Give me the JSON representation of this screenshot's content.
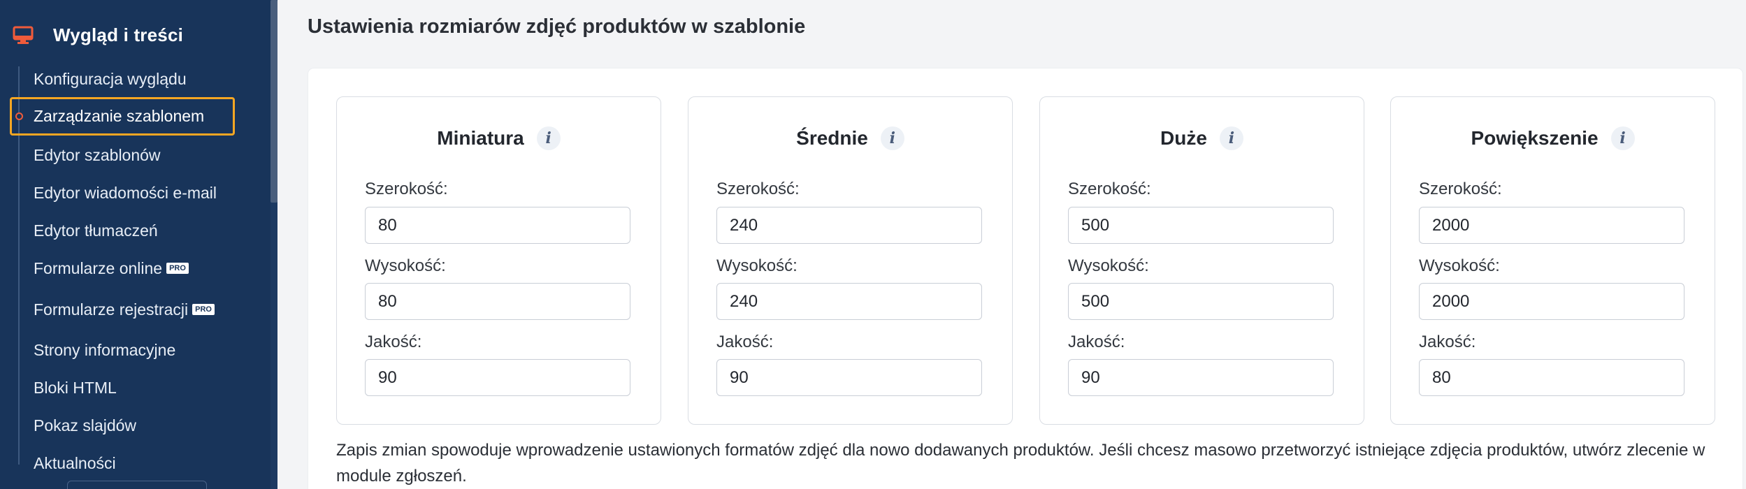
{
  "sidebar": {
    "section_title": "Wygląd i treści",
    "items": [
      {
        "label": "Konfiguracja wyglądu",
        "pro": false
      },
      {
        "label": "Zarządzanie szablonem",
        "pro": false,
        "active": true
      },
      {
        "label": "Edytor szablonów",
        "pro": false
      },
      {
        "label": "Edytor wiadomości e-mail",
        "pro": false
      },
      {
        "label": "Edytor tłumaczeń",
        "pro": false
      },
      {
        "label": "Formularze online",
        "pro": true
      },
      {
        "label": "Formularze rejestracji",
        "pro": true
      },
      {
        "label": "Strony informacyjne",
        "pro": false
      },
      {
        "label": "Bloki HTML",
        "pro": false
      },
      {
        "label": "Pokaz slajdów",
        "pro": false
      },
      {
        "label": "Aktualności",
        "pro": false
      }
    ],
    "pro_badge": "PRO"
  },
  "main": {
    "title": "Ustawienia rozmiarów zdjęć produktów w szablonie",
    "labels": {
      "width": "Szerokość:",
      "height": "Wysokość:",
      "quality": "Jakość:"
    },
    "cards": [
      {
        "title": "Miniatura",
        "width": "80",
        "height": "80",
        "quality": "90"
      },
      {
        "title": "Średnie",
        "width": "240",
        "height": "240",
        "quality": "90"
      },
      {
        "title": "Duże",
        "width": "500",
        "height": "500",
        "quality": "90"
      },
      {
        "title": "Powiększenie",
        "width": "2000",
        "height": "2000",
        "quality": "80"
      }
    ],
    "info_glyph": "i",
    "notice": "Zapis zmian spowoduje wprowadzenie ustawionych formatów zdjęć dla nowo dodawanych produktów. Jeśli chcesz masowo przetworzyć istniejące zdjęcia produktów, utwórz zlecenie w module zgłoszeń."
  },
  "colors": {
    "sidebar_bg": "#18345a",
    "active_outline": "#f5a623",
    "accent_icon": "#ef5b3b"
  }
}
